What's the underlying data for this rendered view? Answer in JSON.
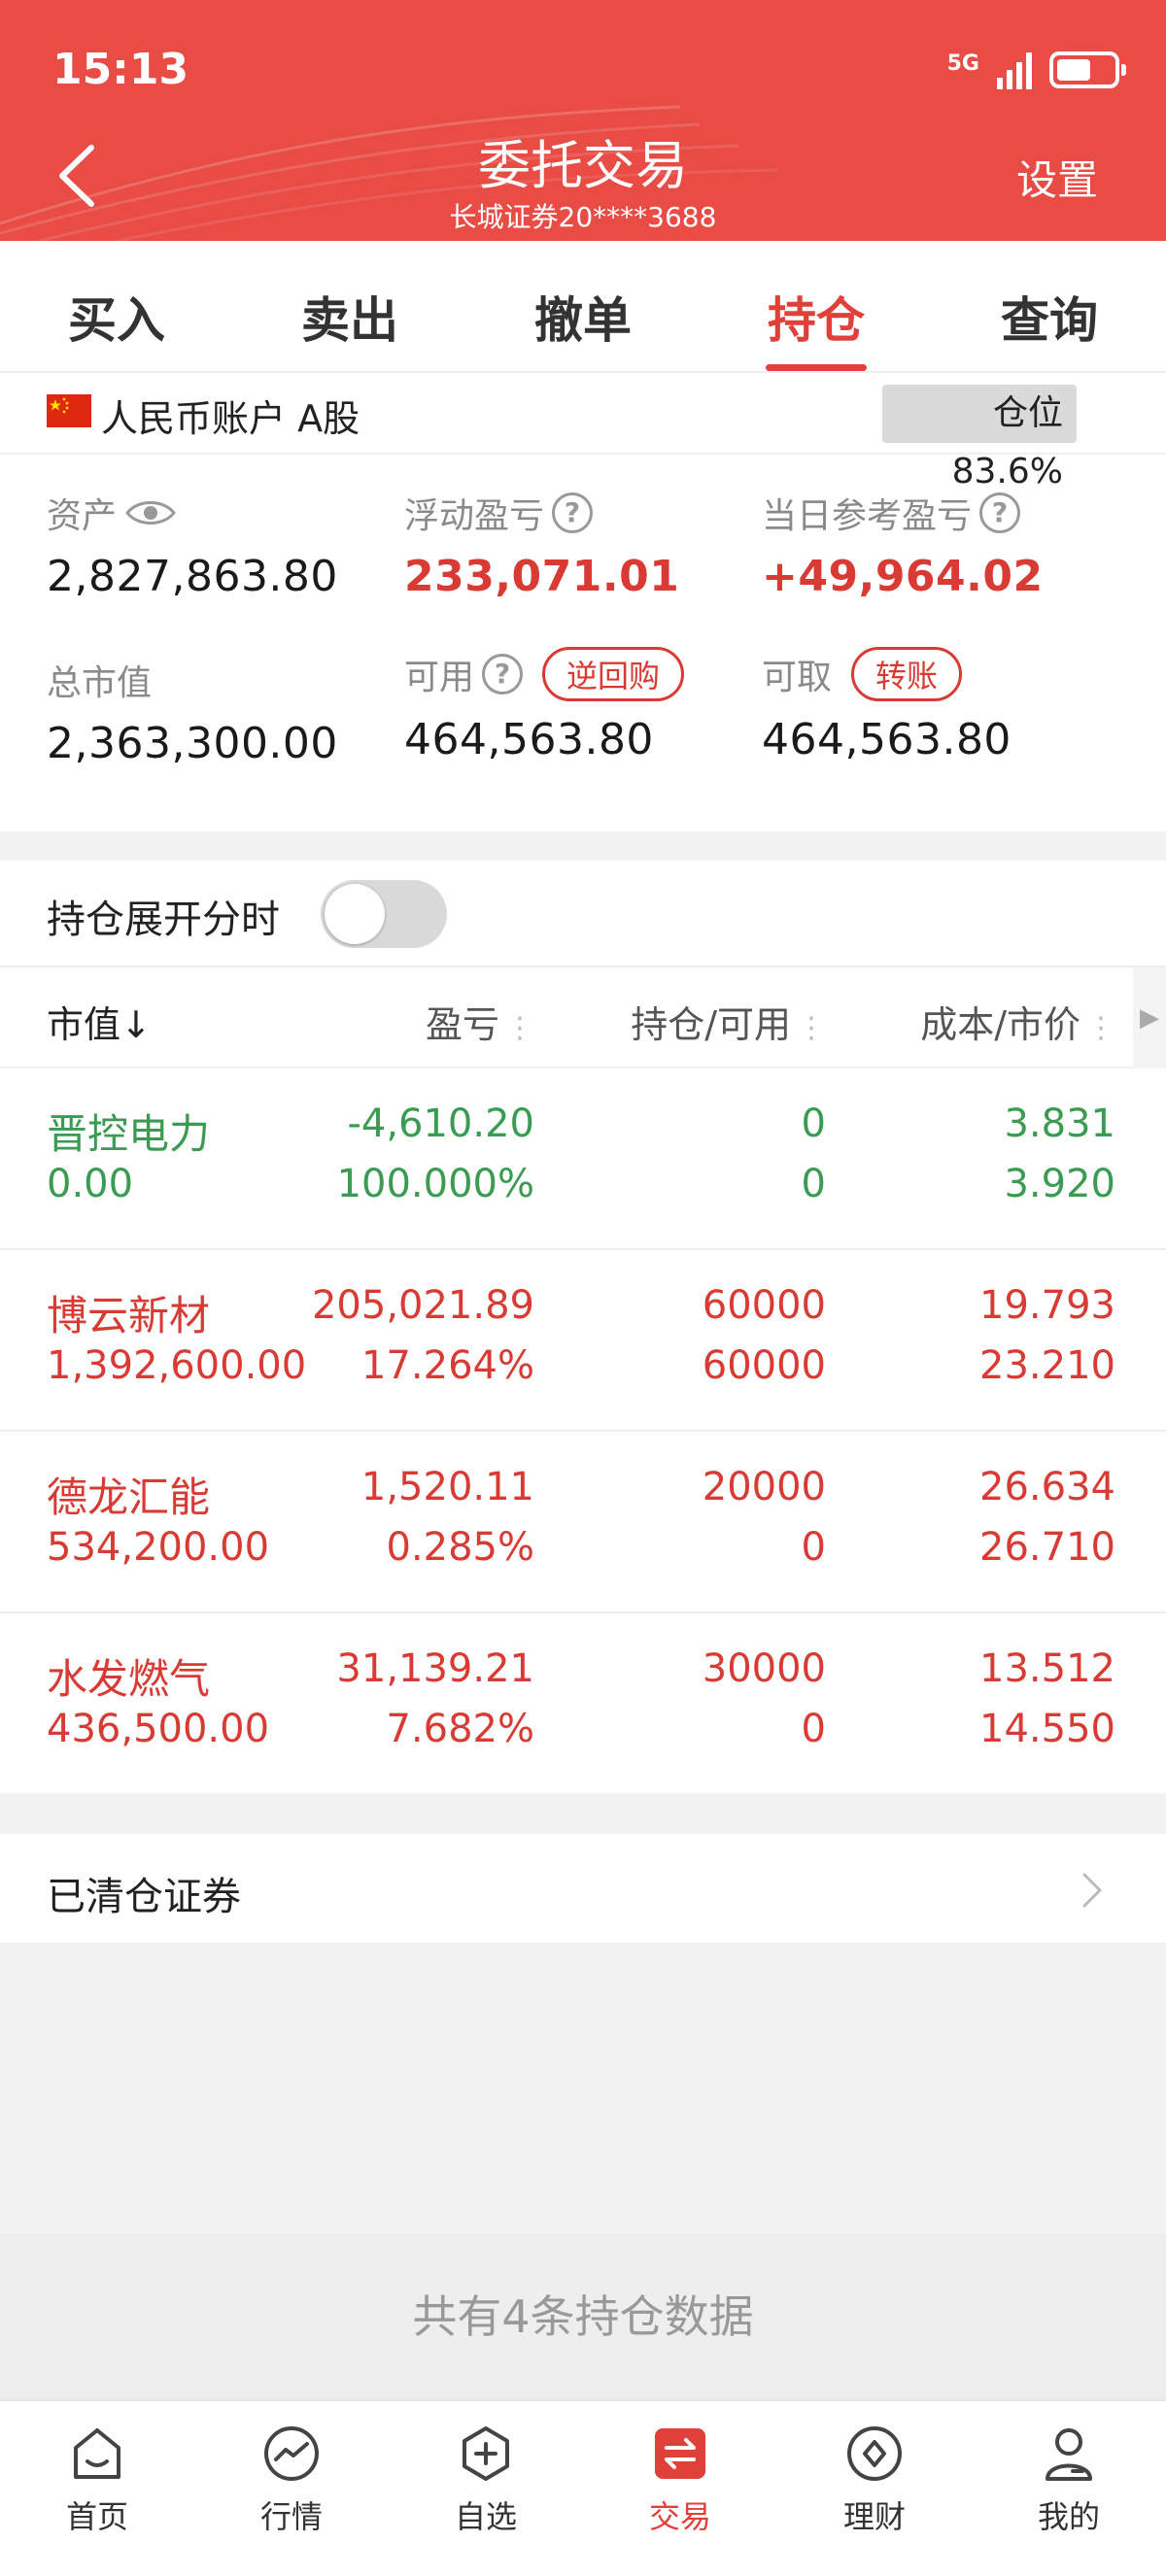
{
  "status_bar": {
    "time": "15:13",
    "network": "5G"
  },
  "header": {
    "title": "委托交易",
    "subtitle": "长城证券20****3688",
    "settings_label": "设置"
  },
  "tabs": [
    {
      "label": "买入"
    },
    {
      "label": "卖出"
    },
    {
      "label": "撤单"
    },
    {
      "label": "持仓",
      "active": true
    },
    {
      "label": "查询"
    }
  ],
  "account": {
    "label": "人民币账户 A股",
    "position_ratio": "仓位83.6%",
    "assets_label": "资产",
    "assets_value": "2,827,863.80",
    "floating_pl_label": "浮动盈亏",
    "floating_pl_value": "233,071.01",
    "daily_pl_label": "当日参考盈亏",
    "daily_pl_value": "+49,964.02",
    "market_value_label": "总市值",
    "market_value_value": "2,363,300.00",
    "available_label": "可用",
    "available_value": "464,563.80",
    "reverse_repo_label": "逆回购",
    "withdrawable_label": "可取",
    "withdrawable_value": "464,563.80",
    "transfer_label": "转账"
  },
  "toggle": {
    "label": "持仓展开分时",
    "on": false
  },
  "table": {
    "headers": [
      "市值↓",
      "盈亏",
      "持仓/可用",
      "成本/市价"
    ],
    "rows": [
      {
        "name": "晋控电力",
        "market_value": "0.00",
        "pl": "-4,610.20",
        "pl_pct": "100.000%",
        "position": "0",
        "available": "0",
        "cost": "3.831",
        "price": "3.920",
        "color": "#3a9b52"
      },
      {
        "name": "博云新材",
        "market_value": "1,392,600.00",
        "pl": "205,021.89",
        "pl_pct": "17.264%",
        "position": "60000",
        "available": "60000",
        "cost": "19.793",
        "price": "23.210",
        "color": "#d93a33"
      },
      {
        "name": "德龙汇能",
        "market_value": "534,200.00",
        "pl": "1,520.11",
        "pl_pct": "0.285%",
        "position": "20000",
        "available": "0",
        "cost": "26.634",
        "price": "26.710",
        "color": "#d93a33"
      },
      {
        "name": "水发燃气",
        "market_value": "436,500.00",
        "pl": "31,139.21",
        "pl_pct": "7.682%",
        "position": "30000",
        "available": "0",
        "cost": "13.512",
        "price": "14.550",
        "color": "#d93a33"
      }
    ]
  },
  "cleared": {
    "label": "已清仓证券"
  },
  "footer_note": "共有4条持仓数据",
  "bottom_nav": [
    {
      "label": "首页",
      "icon": "home-icon"
    },
    {
      "label": "行情",
      "icon": "market-icon"
    },
    {
      "label": "自选",
      "icon": "watchlist-icon"
    },
    {
      "label": "交易",
      "icon": "trade-icon",
      "active": true
    },
    {
      "label": "理财",
      "icon": "wealth-icon"
    },
    {
      "label": "我的",
      "icon": "profile-icon"
    }
  ],
  "colors": {
    "brand_red": "#e84c45",
    "accent_red": "#d93a33",
    "loss_green": "#3a9b52"
  }
}
